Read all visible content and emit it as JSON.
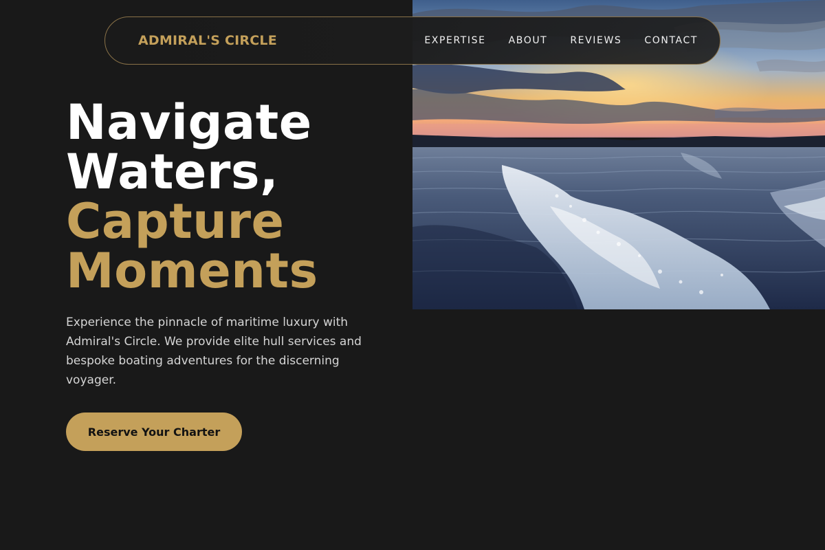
{
  "brand": {
    "name": "ADMIRAL'S CIRCLE"
  },
  "nav": {
    "items": [
      {
        "label": "EXPERTISE"
      },
      {
        "label": "ABOUT"
      },
      {
        "label": "REVIEWS"
      },
      {
        "label": "CONTACT"
      }
    ]
  },
  "hero": {
    "headline_line1": "Navigate",
    "headline_line2": "Waters,",
    "headline_accent1": "Capture",
    "headline_accent2": "Moments",
    "description": "Experience the pinnacle of maritime luxury with Admiral's Circle. We provide elite hull services and bespoke boating adventures for the discerning voyager.",
    "cta_label": "Reserve Your Charter"
  },
  "colors": {
    "background": "#191919",
    "accent_gold": "#c4a05a",
    "text_white": "#ffffff",
    "text_muted": "#d5d5d5"
  }
}
